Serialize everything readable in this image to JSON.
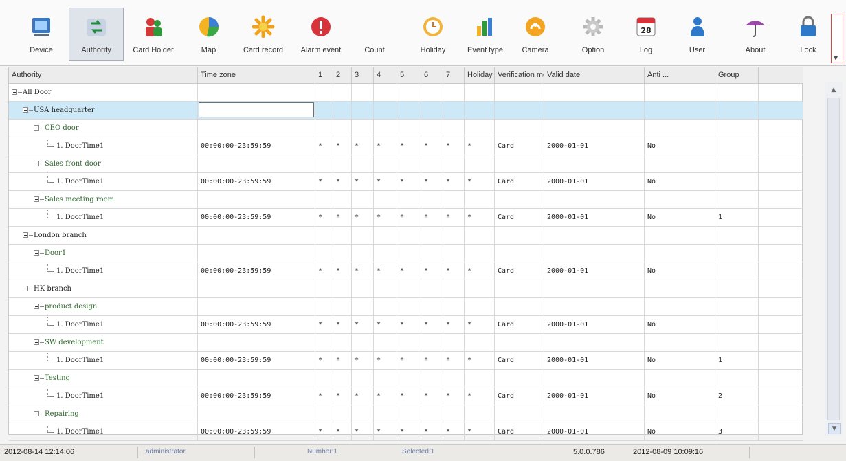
{
  "toolbar": {
    "items": [
      {
        "label": "Device",
        "icon": "device-icon"
      },
      {
        "label": "Authority",
        "icon": "authority-icon"
      },
      {
        "label": "Card Holder",
        "icon": "card-holder-icon"
      },
      {
        "label": "Map",
        "icon": "map-icon"
      },
      {
        "label": "Card record",
        "icon": "card-record-icon"
      },
      {
        "label": "Alarm event",
        "icon": "alarm-event-icon"
      },
      {
        "label": "Count",
        "icon": "count-icon"
      },
      {
        "label": "Holiday",
        "icon": "holiday-icon"
      },
      {
        "label": "Event type",
        "icon": "event-type-icon"
      },
      {
        "label": "Camera",
        "icon": "camera-icon"
      },
      {
        "label": "Option",
        "icon": "option-icon"
      },
      {
        "label": "Log",
        "icon": "log-icon"
      },
      {
        "label": "User",
        "icon": "user-icon"
      },
      {
        "label": "About",
        "icon": "about-icon"
      },
      {
        "label": "Lock",
        "icon": "lock-icon"
      }
    ],
    "active": "Authority",
    "log_day": "28"
  },
  "grid": {
    "headers": [
      "Authority",
      "Time zone",
      "1",
      "2",
      "3",
      "4",
      "5",
      "6",
      "7",
      "Holiday",
      "Verification method",
      "Valid date",
      "Anti ...",
      "Group"
    ],
    "rows": [
      {
        "level": 0,
        "tree": "All Door",
        "expand": true,
        "cells": [
          "",
          "",
          "",
          "",
          "",
          "",
          "",
          "",
          "",
          "",
          "",
          "",
          ""
        ]
      },
      {
        "level": 1,
        "tree": "USA headquarter",
        "expand": true,
        "selected": true,
        "cells": [
          "",
          "",
          "",
          "",
          "",
          "",
          "",
          "",
          "",
          "",
          "",
          "",
          ""
        ]
      },
      {
        "level": 2,
        "tree": "CEO door",
        "expand": true,
        "cells": [
          "",
          "",
          "",
          "",
          "",
          "",
          "",
          "",
          "",
          "",
          "",
          "",
          ""
        ]
      },
      {
        "level": 3,
        "tree": "1. DoorTime1",
        "cells": [
          "00:00:00-23:59:59",
          "*",
          "*",
          "*",
          "*",
          "*",
          "*",
          "*",
          "*",
          "Card",
          "2000-01-01",
          "No",
          ""
        ]
      },
      {
        "level": 2,
        "tree": "Sales front door",
        "expand": true,
        "cells": [
          "",
          "",
          "",
          "",
          "",
          "",
          "",
          "",
          "",
          "",
          "",
          "",
          ""
        ]
      },
      {
        "level": 3,
        "tree": "1. DoorTime1",
        "cells": [
          "00:00:00-23:59:59",
          "*",
          "*",
          "*",
          "*",
          "*",
          "*",
          "*",
          "*",
          "Card",
          "2000-01-01",
          "No",
          ""
        ]
      },
      {
        "level": 2,
        "tree": "Sales meeting room",
        "expand": true,
        "cells": [
          "",
          "",
          "",
          "",
          "",
          "",
          "",
          "",
          "",
          "",
          "",
          "",
          ""
        ]
      },
      {
        "level": 3,
        "tree": "1. DoorTime1",
        "cells": [
          "00:00:00-23:59:59",
          "*",
          "*",
          "*",
          "*",
          "*",
          "*",
          "*",
          "*",
          "Card",
          "2000-01-01",
          "No",
          "1"
        ]
      },
      {
        "level": 1,
        "tree": "London branch",
        "expand": true,
        "cells": [
          "",
          "",
          "",
          "",
          "",
          "",
          "",
          "",
          "",
          "",
          "",
          "",
          ""
        ]
      },
      {
        "level": 2,
        "tree": "Door1",
        "expand": true,
        "cells": [
          "",
          "",
          "",
          "",
          "",
          "",
          "",
          "",
          "",
          "",
          "",
          "",
          ""
        ]
      },
      {
        "level": 3,
        "tree": "1. DoorTime1",
        "cells": [
          "00:00:00-23:59:59",
          "*",
          "*",
          "*",
          "*",
          "*",
          "*",
          "*",
          "*",
          "Card",
          "2000-01-01",
          "No",
          ""
        ]
      },
      {
        "level": 1,
        "tree": "HK branch",
        "expand": true,
        "cells": [
          "",
          "",
          "",
          "",
          "",
          "",
          "",
          "",
          "",
          "",
          "",
          "",
          ""
        ]
      },
      {
        "level": 2,
        "tree": "product design",
        "expand": true,
        "cells": [
          "",
          "",
          "",
          "",
          "",
          "",
          "",
          "",
          "",
          "",
          "",
          "",
          ""
        ]
      },
      {
        "level": 3,
        "tree": "1. DoorTime1",
        "cells": [
          "00:00:00-23:59:59",
          "*",
          "*",
          "*",
          "*",
          "*",
          "*",
          "*",
          "*",
          "Card",
          "2000-01-01",
          "No",
          ""
        ]
      },
      {
        "level": 2,
        "tree": "SW development",
        "expand": true,
        "cells": [
          "",
          "",
          "",
          "",
          "",
          "",
          "",
          "",
          "",
          "",
          "",
          "",
          ""
        ]
      },
      {
        "level": 3,
        "tree": "1. DoorTime1",
        "cells": [
          "00:00:00-23:59:59",
          "*",
          "*",
          "*",
          "*",
          "*",
          "*",
          "*",
          "*",
          "Card",
          "2000-01-01",
          "No",
          "1"
        ]
      },
      {
        "level": 2,
        "tree": "Testing",
        "expand": true,
        "cells": [
          "",
          "",
          "",
          "",
          "",
          "",
          "",
          "",
          "",
          "",
          "",
          "",
          ""
        ]
      },
      {
        "level": 3,
        "tree": "1. DoorTime1",
        "cells": [
          "00:00:00-23:59:59",
          "*",
          "*",
          "*",
          "*",
          "*",
          "*",
          "*",
          "*",
          "Card",
          "2000-01-01",
          "No",
          "2"
        ]
      },
      {
        "level": 2,
        "tree": "Repairing",
        "expand": true,
        "cells": [
          "",
          "",
          "",
          "",
          "",
          "",
          "",
          "",
          "",
          "",
          "",
          "",
          ""
        ]
      },
      {
        "level": 3,
        "tree": "1. DoorTime1",
        "cells": [
          "00:00:00-23:59:59",
          "*",
          "*",
          "*",
          "*",
          "*",
          "*",
          "*",
          "*",
          "Card",
          "2000-01-01",
          "No",
          "3"
        ]
      }
    ]
  },
  "status": {
    "datetime": "2012-08-14 12:14:06",
    "user": "administrator",
    "number": "Number:1",
    "selected": "Selected:1",
    "version": "5.0.0.786",
    "build_date": "2012-08-09 10:09:16"
  },
  "colors": {
    "selected_row": "#cde8f6",
    "tree_green": "#2f6a2f",
    "more_border": "#d24848"
  }
}
